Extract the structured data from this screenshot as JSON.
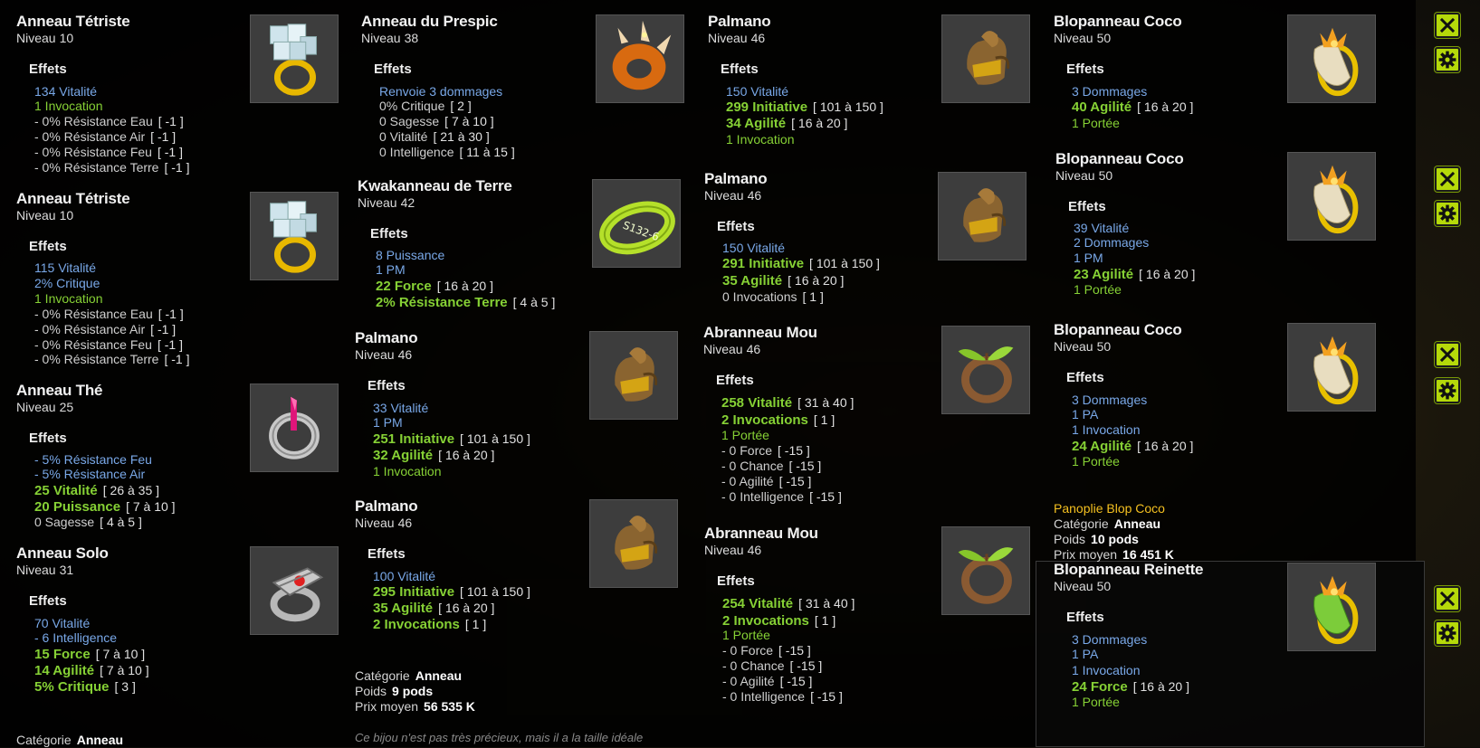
{
  "col1": [
    {
      "name": "Anneau Tétriste",
      "level_label": "Niveau",
      "level": "10",
      "effects_title": "Effets",
      "effects": [
        {
          "text": "134 Vitalité",
          "color": "blue"
        },
        {
          "text": "1 Invocation",
          "color": "green"
        },
        {
          "text": "- 0% Résistance Eau",
          "range": "[ -1 ]",
          "color": "grey"
        },
        {
          "text": "- 0% Résistance Air",
          "range": "[ -1 ]",
          "color": "grey"
        },
        {
          "text": "- 0% Résistance Feu",
          "range": "[ -1 ]",
          "color": "grey"
        },
        {
          "text": "- 0% Résistance Terre",
          "range": "[ -1 ]",
          "color": "grey"
        }
      ]
    },
    {
      "name": "Anneau Tétriste",
      "level_label": "Niveau",
      "level": "10",
      "effects_title": "Effets",
      "effects": [
        {
          "text": "115 Vitalité",
          "color": "blue"
        },
        {
          "text": "2% Critique",
          "color": "blue"
        },
        {
          "text": "1 Invocation",
          "color": "green"
        },
        {
          "text": "- 0% Résistance Eau",
          "range": "[ -1 ]",
          "color": "grey"
        },
        {
          "text": "- 0% Résistance Air",
          "range": "[ -1 ]",
          "color": "grey"
        },
        {
          "text": "- 0% Résistance Feu",
          "range": "[ -1 ]",
          "color": "grey"
        },
        {
          "text": "- 0% Résistance Terre",
          "range": "[ -1 ]",
          "color": "grey"
        }
      ]
    },
    {
      "name": "Anneau Thé",
      "level_label": "Niveau",
      "level": "25",
      "effects_title": "Effets",
      "effects": [
        {
          "text": "- 5% Résistance Feu",
          "color": "blue"
        },
        {
          "text": "- 5% Résistance Air",
          "color": "blue"
        },
        {
          "text": "25 Vitalité",
          "range": "[ 26 à 35 ]",
          "color": "greenb"
        },
        {
          "text": "20 Puissance",
          "range": "[ 7 à 10 ]",
          "color": "greenb"
        },
        {
          "text": "0 Sagesse",
          "range": "[ 4 à 5 ]",
          "color": "grey"
        }
      ]
    },
    {
      "name": "Anneau Solo",
      "level_label": "Niveau",
      "level": "31",
      "effects_title": "Effets",
      "effects": [
        {
          "text": "70 Vitalité",
          "color": "blue"
        },
        {
          "text": "- 6 Intelligence",
          "color": "blue"
        },
        {
          "text": "15 Force",
          "range": "[ 7 à 10 ]",
          "color": "greenb"
        },
        {
          "text": "14 Agilité",
          "range": "[ 7 à 10 ]",
          "color": "greenb"
        },
        {
          "text": "5% Critique",
          "range": "[ 3 ]",
          "color": "greenb"
        }
      ]
    }
  ],
  "col2": [
    {
      "name": "Anneau du Prespic",
      "level_label": "Niveau",
      "level": "38",
      "effects_title": "Effets",
      "effects": [
        {
          "text": "Renvoie 3 dommages",
          "color": "blue"
        },
        {
          "text": "0% Critique",
          "range": "[ 2 ]",
          "color": "grey"
        },
        {
          "text": "0 Sagesse",
          "range": "[ 7 à 10 ]",
          "color": "grey"
        },
        {
          "text": "0 Vitalité",
          "range": "[ 21 à 30 ]",
          "color": "grey"
        },
        {
          "text": "0 Intelligence",
          "range": "[ 11 à 15 ]",
          "color": "grey"
        }
      ]
    },
    {
      "name": "Kwakanneau de Terre",
      "level_label": "Niveau",
      "level": "42",
      "effects_title": "Effets",
      "effects": [
        {
          "text": "8 Puissance",
          "color": "blue"
        },
        {
          "text": "1 PM",
          "color": "blue"
        },
        {
          "text": "22 Force",
          "range": "[ 16 à 20 ]",
          "color": "greenb"
        },
        {
          "text": "2% Résistance Terre",
          "range": "[ 4 à 5 ]",
          "color": "greenb"
        }
      ]
    },
    {
      "name": "Palmano",
      "level_label": "Niveau",
      "level": "46",
      "effects_title": "Effets",
      "effects": [
        {
          "text": "33 Vitalité",
          "color": "blue"
        },
        {
          "text": "1 PM",
          "color": "blue"
        },
        {
          "text": "251 Initiative",
          "range": "[ 101 à 150 ]",
          "color": "greenb"
        },
        {
          "text": "32 Agilité",
          "range": "[ 16 à 20 ]",
          "color": "greenb"
        },
        {
          "text": "1 Invocation",
          "color": "green"
        }
      ]
    },
    {
      "name": "Palmano",
      "level_label": "Niveau",
      "level": "46",
      "effects_title": "Effets",
      "effects": [
        {
          "text": "100 Vitalité",
          "color": "blue"
        },
        {
          "text": "295 Initiative",
          "range": "[ 101 à 150 ]",
          "color": "greenb"
        },
        {
          "text": "35 Agilité",
          "range": "[ 16 à 20 ]",
          "color": "greenb"
        },
        {
          "text": "2 Invocations",
          "range": "[ 1 ]",
          "color": "greenb"
        }
      ],
      "meta": {
        "category_label": "Catégorie",
        "category": "Anneau",
        "weight_label": "Poids",
        "weight": "9 pods",
        "price_label": "Prix moyen",
        "price": "56 535 K"
      },
      "desc": "Ce bijou n'est pas très précieux, mais il a la taille idéale"
    }
  ],
  "col3": [
    {
      "name": "Palmano",
      "level_label": "Niveau",
      "level": "46",
      "effects_title": "Effets",
      "effects": [
        {
          "text": "150 Vitalité",
          "color": "blue"
        },
        {
          "text": "299 Initiative",
          "range": "[ 101 à 150 ]",
          "color": "greenb"
        },
        {
          "text": "34 Agilité",
          "range": "[ 16 à 20 ]",
          "color": "greenb"
        },
        {
          "text": "1 Invocation",
          "color": "green"
        }
      ]
    },
    {
      "name": "Palmano",
      "level_label": "Niveau",
      "level": "46",
      "effects_title": "Effets",
      "effects": [
        {
          "text": "150 Vitalité",
          "color": "blue"
        },
        {
          "text": "291 Initiative",
          "range": "[ 101 à 150 ]",
          "color": "greenb"
        },
        {
          "text": "35 Agilité",
          "range": "[ 16 à 20 ]",
          "color": "greenb"
        },
        {
          "text": "0 Invocations",
          "range": "[ 1 ]",
          "color": "grey"
        }
      ]
    },
    {
      "name": "Abranneau Mou",
      "level_label": "Niveau",
      "level": "46",
      "effects_title": "Effets",
      "effects": [
        {
          "text": "258 Vitalité",
          "range": "[ 31 à 40 ]",
          "color": "greenb"
        },
        {
          "text": "2 Invocations",
          "range": "[ 1 ]",
          "color": "greenb"
        },
        {
          "text": "1 Portée",
          "color": "green"
        },
        {
          "text": "- 0 Force",
          "range": "[ -15 ]",
          "color": "grey"
        },
        {
          "text": "- 0 Chance",
          "range": "[ -15 ]",
          "color": "grey"
        },
        {
          "text": "- 0 Agilité",
          "range": "[ -15 ]",
          "color": "grey"
        },
        {
          "text": "- 0 Intelligence",
          "range": "[ -15 ]",
          "color": "grey"
        }
      ]
    },
    {
      "name": "Abranneau Mou",
      "level_label": "Niveau",
      "level": "46",
      "effects_title": "Effets",
      "effects": [
        {
          "text": "254 Vitalité",
          "range": "[ 31 à 40 ]",
          "color": "greenb"
        },
        {
          "text": "2 Invocations",
          "range": "[ 1 ]",
          "color": "greenb"
        },
        {
          "text": "1 Portée",
          "color": "green"
        },
        {
          "text": "- 0 Force",
          "range": "[ -15 ]",
          "color": "grey"
        },
        {
          "text": "- 0 Chance",
          "range": "[ -15 ]",
          "color": "grey"
        },
        {
          "text": "- 0 Agilité",
          "range": "[ -15 ]",
          "color": "grey"
        },
        {
          "text": "- 0 Intelligence",
          "range": "[ -15 ]",
          "color": "grey"
        }
      ]
    }
  ],
  "col4": [
    {
      "name": "Blopanneau Coco",
      "level_label": "Niveau",
      "level": "50",
      "effects_title": "Effets",
      "effects": [
        {
          "text": "3 Dommages",
          "color": "blue"
        },
        {
          "text": "40 Agilité",
          "range": "[ 16 à 20 ]",
          "color": "greenb"
        },
        {
          "text": "1 Portée",
          "color": "green"
        }
      ]
    },
    {
      "name": "Blopanneau Coco",
      "level_label": "Niveau",
      "level": "50",
      "effects_title": "Effets",
      "effects": [
        {
          "text": "39 Vitalité",
          "color": "blue"
        },
        {
          "text": "2 Dommages",
          "color": "blue"
        },
        {
          "text": "1 PM",
          "color": "blue"
        },
        {
          "text": "23 Agilité",
          "range": "[ 16 à 20 ]",
          "color": "greenb"
        },
        {
          "text": "1 Portée",
          "color": "green"
        }
      ]
    },
    {
      "name": "Blopanneau Coco",
      "level_label": "Niveau",
      "level": "50",
      "effects_title": "Effets",
      "effects": [
        {
          "text": "3 Dommages",
          "color": "blue"
        },
        {
          "text": "1 PA",
          "color": "blue"
        },
        {
          "text": "1 Invocation",
          "color": "blue"
        },
        {
          "text": "24 Agilité",
          "range": "[ 16 à 20 ]",
          "color": "greenb"
        },
        {
          "text": "1 Portée",
          "color": "green"
        }
      ],
      "meta": {
        "set": "Panoplie Blop Coco",
        "category_label": "Catégorie",
        "category": "Anneau",
        "weight_label": "Poids",
        "weight": "10 pods",
        "price_label": "Prix moyen",
        "price": "16 451 K"
      }
    },
    {
      "name": "Blopanneau Reinette",
      "level_label": "Niveau",
      "level": "50",
      "effects_title": "Effets",
      "effects": [
        {
          "text": "3 Dommages",
          "color": "blue"
        },
        {
          "text": "1 PA",
          "color": "blue"
        },
        {
          "text": "1 Invocation",
          "color": "blue"
        },
        {
          "text": "24 Force",
          "range": "[ 16 à 20 ]",
          "color": "greenb"
        },
        {
          "text": "1 Portée",
          "color": "green"
        }
      ]
    }
  ],
  "col1_tail": {
    "category_label": "Catégorie",
    "category": "Anneau"
  },
  "colors": {
    "effect_blue": "#79a8e8",
    "effect_green": "#86d135",
    "set_yellow": "#f4c020",
    "button_lime": "#b5d90a"
  },
  "icons": {
    "close": "close-icon",
    "settings": "gear-icon"
  }
}
